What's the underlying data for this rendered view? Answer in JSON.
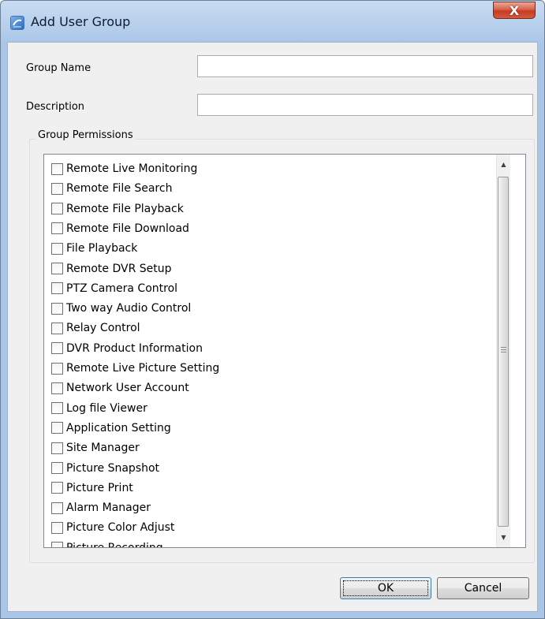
{
  "window": {
    "title": "Add User Group",
    "close_label": "X"
  },
  "form": {
    "group_name": {
      "label": "Group Name",
      "value": "",
      "placeholder": ""
    },
    "description": {
      "label": "Description",
      "value": "",
      "placeholder": ""
    }
  },
  "permissions": {
    "title": "Group Permissions",
    "items": [
      {
        "label": "Remote Live Monitoring",
        "checked": false
      },
      {
        "label": "Remote File Search",
        "checked": false
      },
      {
        "label": "Remote File Playback",
        "checked": false
      },
      {
        "label": "Remote File Download",
        "checked": false
      },
      {
        "label": "File Playback",
        "checked": false
      },
      {
        "label": "Remote DVR Setup",
        "checked": false
      },
      {
        "label": "PTZ Camera Control",
        "checked": false
      },
      {
        "label": "Two way Audio Control",
        "checked": false
      },
      {
        "label": "Relay Control",
        "checked": false
      },
      {
        "label": "DVR Product Information",
        "checked": false
      },
      {
        "label": "Remote Live Picture Setting",
        "checked": false
      },
      {
        "label": "Network User Account",
        "checked": false
      },
      {
        "label": "Log file Viewer",
        "checked": false
      },
      {
        "label": "Application Setting",
        "checked": false
      },
      {
        "label": "Site Manager",
        "checked": false
      },
      {
        "label": "Picture Snapshot",
        "checked": false
      },
      {
        "label": "Picture Print",
        "checked": false
      },
      {
        "label": "Alarm Manager",
        "checked": false
      },
      {
        "label": "Picture Color Adjust",
        "checked": false
      },
      {
        "label": "Picture Recording",
        "checked": false
      }
    ]
  },
  "buttons": {
    "ok": "OK",
    "cancel": "Cancel"
  }
}
